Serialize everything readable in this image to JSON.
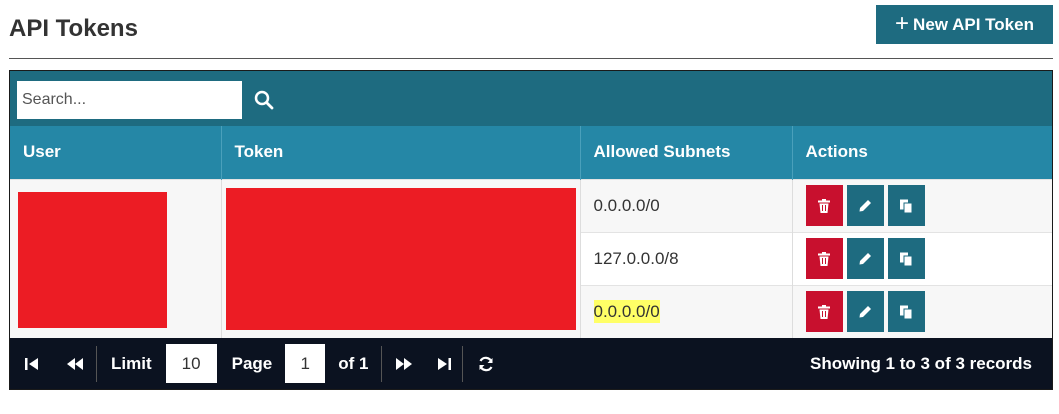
{
  "header": {
    "title": "API Tokens",
    "new_button_label": "New API Token"
  },
  "search": {
    "placeholder": "Search...",
    "value": ""
  },
  "table": {
    "columns": [
      "User",
      "Token",
      "Allowed Subnets",
      "Actions"
    ],
    "rows": [
      {
        "subnet": "0.0.0.0/0",
        "highlighted": false
      },
      {
        "subnet": "127.0.0.0/8",
        "highlighted": false
      },
      {
        "subnet": "0.0.0.0/0",
        "highlighted": true
      }
    ],
    "redaction_color": "#ec1c24"
  },
  "pager": {
    "limit_label": "Limit",
    "limit_value": "10",
    "page_label": "Page",
    "page_value": "1",
    "of_label": "of 1",
    "records_text": "Showing 1 to 3 of 3 records"
  },
  "colors": {
    "primary": "#1e6b80",
    "header_row": "#2587a6",
    "danger": "#c8102e",
    "pager_bg": "#0b1220",
    "highlight": "#ffff66"
  }
}
